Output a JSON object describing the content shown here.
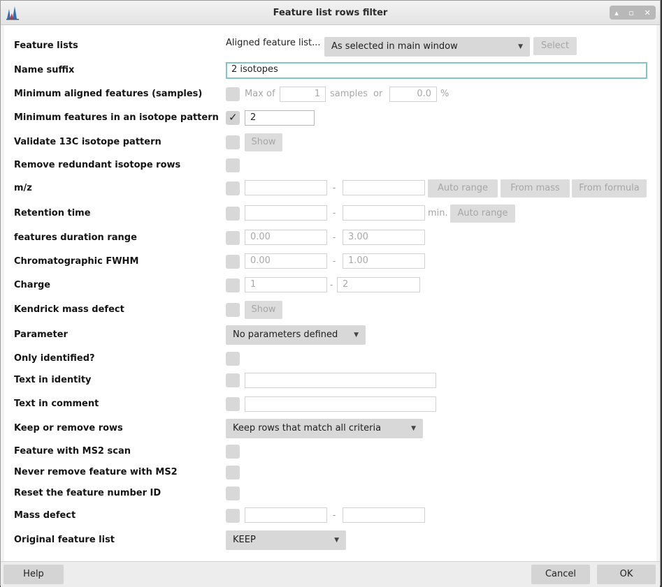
{
  "window": {
    "title": "Feature list rows filter"
  },
  "rows": {
    "feature_lists": {
      "label": "Feature lists",
      "prefix": "Aligned feature list...",
      "combo": "As selected in main window",
      "button": "Select"
    },
    "name_suffix": {
      "label": "Name suffix",
      "value": "2 isotopes"
    },
    "min_aligned": {
      "label": "Minimum aligned features (samples)",
      "max_of": "Max of",
      "count": "1",
      "samples": "samples",
      "or": "or",
      "percent": "0.0",
      "percent_sign": "%"
    },
    "min_isotope": {
      "label": "Minimum features in an isotope pattern",
      "value": "2"
    },
    "validate_13c": {
      "label": "Validate 13C isotope pattern",
      "button": "Show"
    },
    "remove_redundant": {
      "label": "Remove redundant isotope rows"
    },
    "mz": {
      "label": "m/z",
      "btn_auto": "Auto range",
      "btn_mass": "From mass",
      "btn_formula": "From formula"
    },
    "rt": {
      "label": "Retention time",
      "unit": "min.",
      "btn_auto": "Auto range"
    },
    "duration": {
      "label": "features duration range",
      "min": "0.00",
      "max": "3.00"
    },
    "fwhm": {
      "label": "Chromatographic FWHM",
      "min": "0.00",
      "max": "1.00"
    },
    "charge": {
      "label": "Charge",
      "min": "1",
      "max": "2"
    },
    "kendrick": {
      "label": "Kendrick mass defect",
      "button": "Show"
    },
    "parameter": {
      "label": "Parameter",
      "combo": "No parameters defined"
    },
    "only_identified": {
      "label": "Only identified?"
    },
    "text_identity": {
      "label": "Text in identity"
    },
    "text_comment": {
      "label": "Text in comment"
    },
    "keep_remove": {
      "label": "Keep or remove rows",
      "combo": "Keep rows that match all criteria"
    },
    "ms2": {
      "label": "Feature with MS2 scan"
    },
    "never_remove": {
      "label": "Never remove feature with MS2"
    },
    "reset_id": {
      "label": "Reset the feature number ID"
    },
    "mass_defect": {
      "label": "Mass defect"
    },
    "original": {
      "label": "Original feature list",
      "combo": "KEEP"
    }
  },
  "range_dash": "-",
  "footer": {
    "help": "Help",
    "cancel": "Cancel",
    "ok": "OK"
  }
}
